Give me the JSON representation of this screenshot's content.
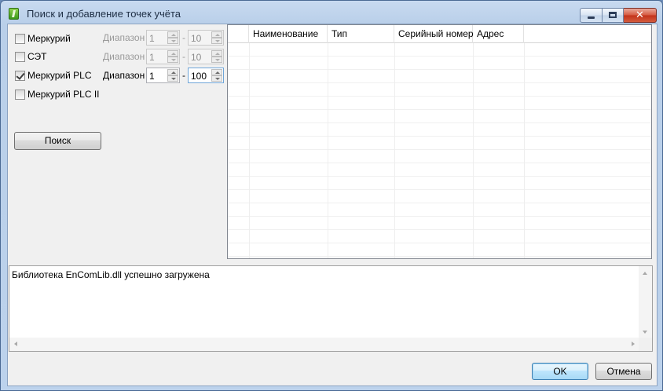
{
  "window": {
    "title": "Поиск и добавление точек учёта"
  },
  "options": [
    {
      "label": "Меркурий",
      "checked": false,
      "range_label": "Диапазон",
      "from": "1",
      "to": "10",
      "enabled": false
    },
    {
      "label": "СЭТ",
      "checked": false,
      "range_label": "Диапазон",
      "from": "1",
      "to": "10",
      "enabled": false
    },
    {
      "label": "Меркурий PLC",
      "checked": true,
      "range_label": "Диапазон",
      "from": "1",
      "to": "100",
      "enabled": true
    },
    {
      "label": "Меркурий PLC II",
      "checked": false
    }
  ],
  "range_separator": "-",
  "search_button": "Поиск",
  "table": {
    "columns": [
      "Наименование",
      "Тип",
      "Серийный номер",
      "Адрес"
    ],
    "rows": []
  },
  "log": {
    "text": "Библиотека EnComLib.dll успешно загружена"
  },
  "buttons": {
    "ok": "OK",
    "cancel": "Отмена"
  }
}
